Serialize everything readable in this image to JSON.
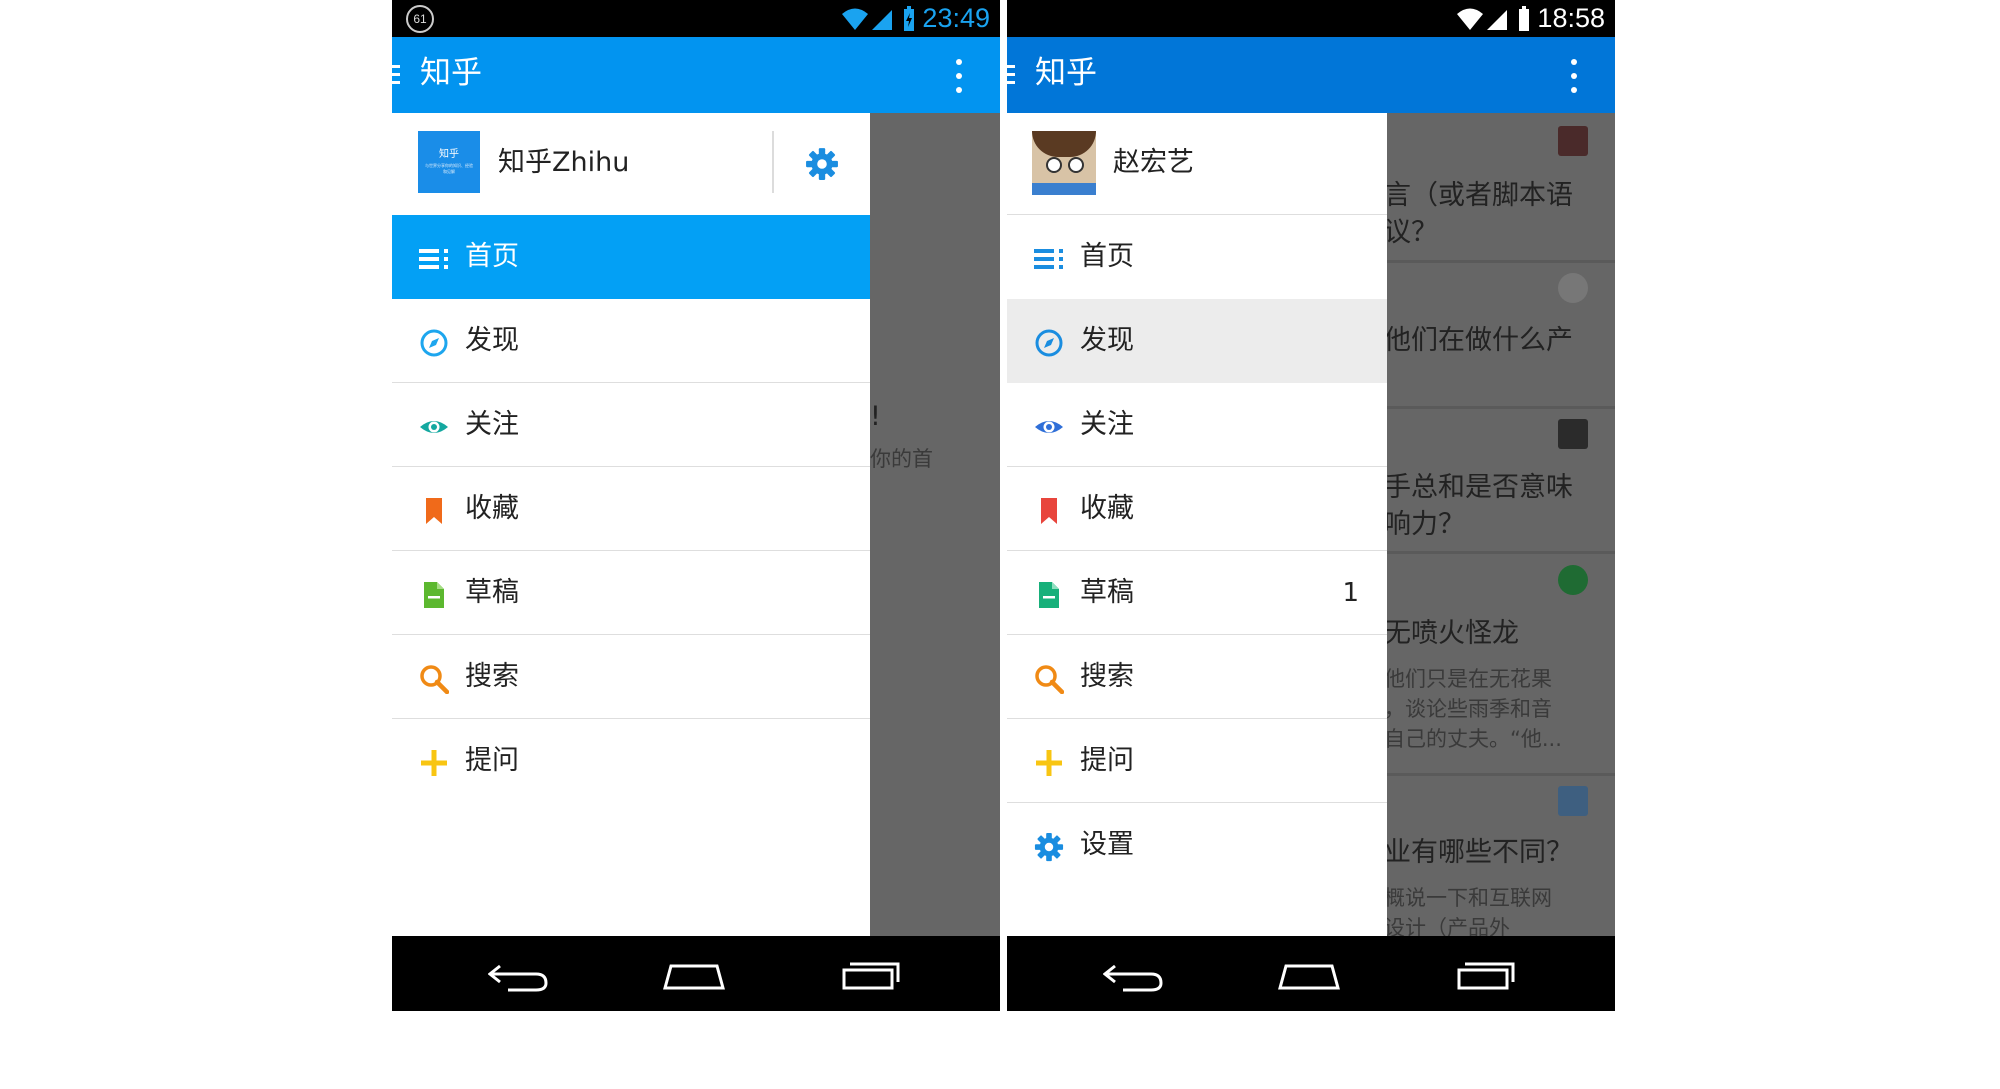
{
  "phone1": {
    "status": {
      "time": "23:49",
      "badge": "61"
    },
    "appbar": {
      "title": "知乎",
      "color": "#0294f0"
    },
    "profile": {
      "name": "知乎Zhihu",
      "logo_text": "知乎",
      "logo_caption": "与世界分享你的知识、经验和见解"
    },
    "menu": [
      {
        "label": "首页",
        "icon": "menu-list-icon",
        "selected": true
      },
      {
        "label": "发现",
        "icon": "compass-icon"
      },
      {
        "label": "关注",
        "icon": "eye-icon"
      },
      {
        "label": "收藏",
        "icon": "bookmark-icon"
      },
      {
        "label": "草稿",
        "icon": "draft-document-icon"
      },
      {
        "label": "搜索",
        "icon": "search-icon"
      },
      {
        "label": "提问",
        "icon": "plus-icon"
      }
    ],
    "background_snippets": [
      "!",
      "你的首"
    ]
  },
  "phone2": {
    "status": {
      "time": "18:58"
    },
    "appbar": {
      "title": "知乎",
      "color": "#0176d8"
    },
    "profile": {
      "name": "赵宏艺"
    },
    "menu": [
      {
        "label": "首页",
        "icon": "menu-list-icon"
      },
      {
        "label": "发现",
        "icon": "compass-icon",
        "selected": true
      },
      {
        "label": "关注",
        "icon": "eye-icon"
      },
      {
        "label": "收藏",
        "icon": "bookmark-icon"
      },
      {
        "label": "草稿",
        "icon": "draft-document-icon",
        "count": "1"
      },
      {
        "label": "搜索",
        "icon": "search-icon"
      },
      {
        "label": "提问",
        "icon": "plus-icon"
      },
      {
        "label": "设置",
        "icon": "gear-icon"
      }
    ],
    "background_snippets": [
      "言（或者脚本语",
      "议？",
      "他们在做什么产",
      "手总和是否意味",
      "响力？",
      "无喷火怪龙",
      "他们只是在无花果",
      "，谈论些雨季和音",
      "自己的丈夫。“他...",
      "业有哪些不同？",
      "概说一下和互联网",
      "设计（产品外"
    ]
  },
  "colors": {
    "selected": "#03a0f5",
    "selected_gray": "#ececec",
    "compass": "#1da6ee",
    "eye_teal": "#14a8a0",
    "eye_blue": "#2f6fd8",
    "bookmark_orange": "#f06a1a",
    "bookmark_red": "#e8453c",
    "draft_green": "#5cb82f",
    "draft_teal": "#17b07a",
    "search": "#f08a15",
    "plus": "#f8c512",
    "gear": "#1a8de0"
  }
}
